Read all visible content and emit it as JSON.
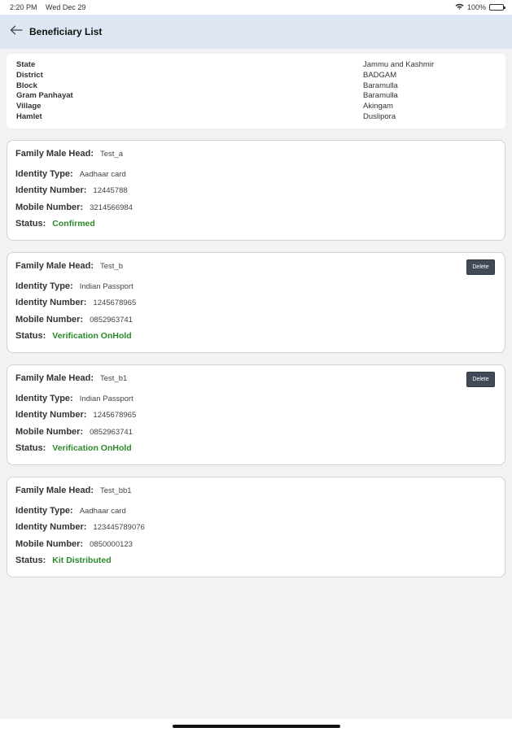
{
  "status_bar": {
    "time": "2:20 PM",
    "date": "Wed Dec 29",
    "battery": "100%"
  },
  "header": {
    "title": "Beneficiary List"
  },
  "location": {
    "rows": [
      {
        "label": "State",
        "value": "Jammu and Kashmir"
      },
      {
        "label": "District",
        "value": "BADGAM"
      },
      {
        "label": "Block",
        "value": "Baramulla"
      },
      {
        "label": "Gram Panhayat",
        "value": "Baramulla"
      },
      {
        "label": "Village",
        "value": "Akingam"
      },
      {
        "label": "Hamlet",
        "value": "Duslipora"
      }
    ]
  },
  "labels": {
    "family_head": "Family Male Head:",
    "identity_type": "Identity Type:",
    "identity_number": "Identity Number:",
    "mobile_number": "Mobile Number:",
    "status": "Status:",
    "delete": "Delete"
  },
  "beneficiaries": [
    {
      "family_head": "Test_a",
      "identity_type": "Aadhaar card",
      "identity_number": "12445788",
      "mobile_number": "3214566984",
      "status": "Confirmed",
      "deletable": false
    },
    {
      "family_head": "Test_b",
      "identity_type": "Indian Passport",
      "identity_number": "1245678965",
      "mobile_number": "0852963741",
      "status": "Verification OnHold",
      "deletable": true
    },
    {
      "family_head": "Test_b1",
      "identity_type": "Indian Passport",
      "identity_number": "1245678965",
      "mobile_number": "0852963741",
      "status": "Verification OnHold",
      "deletable": true
    },
    {
      "family_head": "Test_bb1",
      "identity_type": "Aadhaar card",
      "identity_number": "123445789076",
      "mobile_number": "0850000123",
      "status": "Kit Distributed",
      "deletable": false
    }
  ],
  "colors": {
    "header_bg": "#dde6f2",
    "status_green": "#2a8a2a",
    "delete_bg": "#414b57"
  }
}
